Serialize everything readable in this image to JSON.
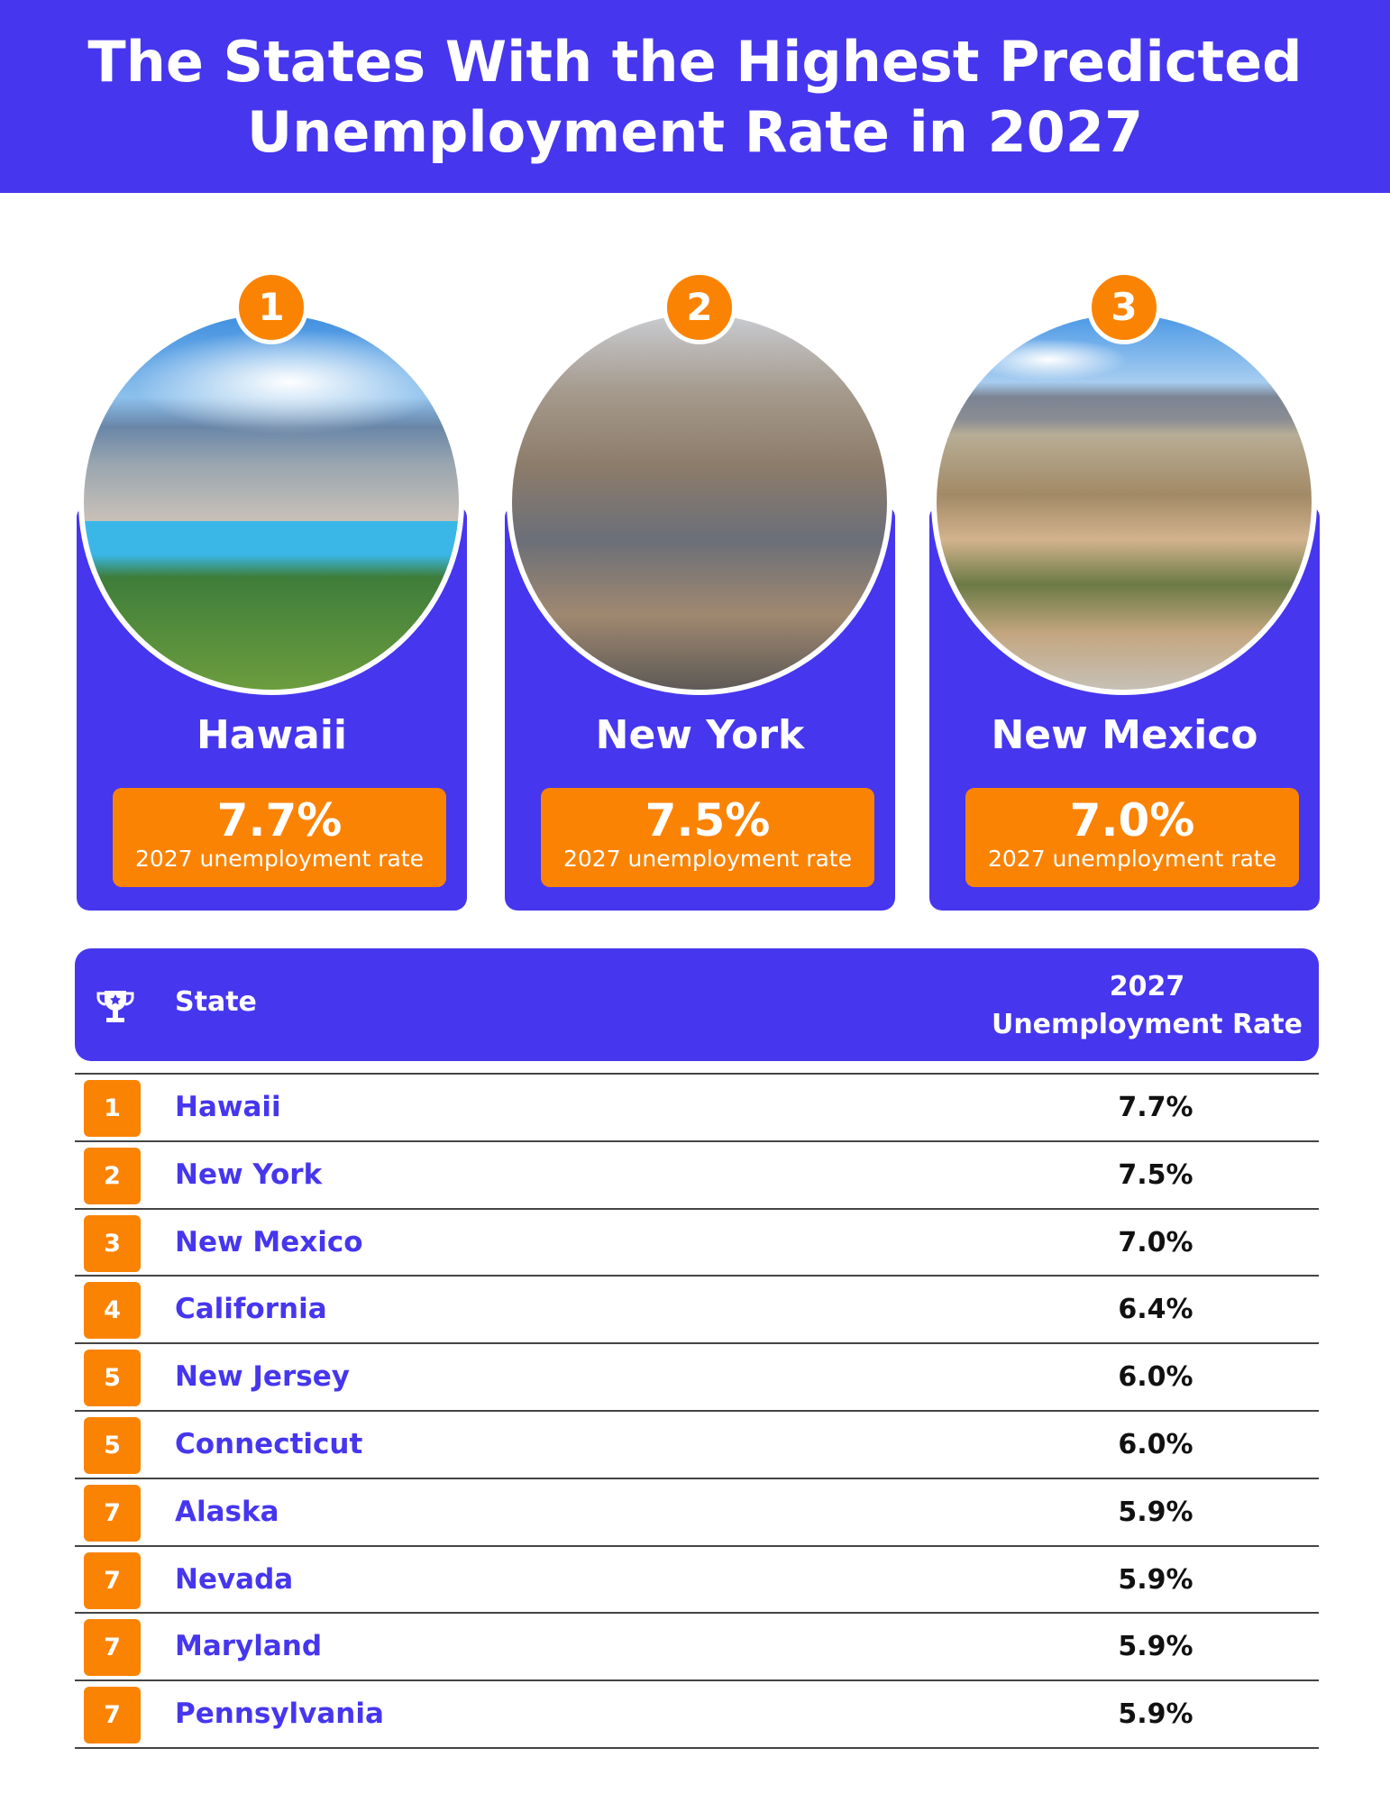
{
  "title": {
    "line1": "The States With the Highest Predicted",
    "line2": "Unemployment Rate in 2027"
  },
  "colors": {
    "primary": "#4636ee",
    "accent": "#fb8304"
  },
  "top3": [
    {
      "rank": "1",
      "state": "Hawaii",
      "rate": "7.7%",
      "label": "2027 unemployment rate",
      "photo": "Honolulu coastline skyline"
    },
    {
      "rank": "2",
      "state": "New York",
      "rate": "7.5%",
      "label": "2027 unemployment rate",
      "photo": "Manhattan skyline aerial"
    },
    {
      "rank": "3",
      "state": "New Mexico",
      "rate": "7.0%",
      "label": "2027 unemployment rate",
      "photo": "Albuquerque suburbs with mountains"
    }
  ],
  "table": {
    "icon": "trophy-icon",
    "col_state": "State",
    "col_rate_line1": "2027",
    "col_rate_line2": "Unemployment Rate",
    "rows": [
      {
        "rank": "1",
        "state": "Hawaii",
        "rate": "7.7%"
      },
      {
        "rank": "2",
        "state": "New York",
        "rate": "7.5%"
      },
      {
        "rank": "3",
        "state": "New Mexico",
        "rate": "7.0%"
      },
      {
        "rank": "4",
        "state": "California",
        "rate": "6.4%"
      },
      {
        "rank": "5",
        "state": "New Jersey",
        "rate": "6.0%"
      },
      {
        "rank": "5",
        "state": "Connecticut",
        "rate": "6.0%"
      },
      {
        "rank": "7",
        "state": "Alaska",
        "rate": "5.9%"
      },
      {
        "rank": "7",
        "state": "Nevada",
        "rate": "5.9%"
      },
      {
        "rank": "7",
        "state": "Maryland",
        "rate": "5.9%"
      },
      {
        "rank": "7",
        "state": "Pennsylvania",
        "rate": "5.9%"
      }
    ]
  }
}
